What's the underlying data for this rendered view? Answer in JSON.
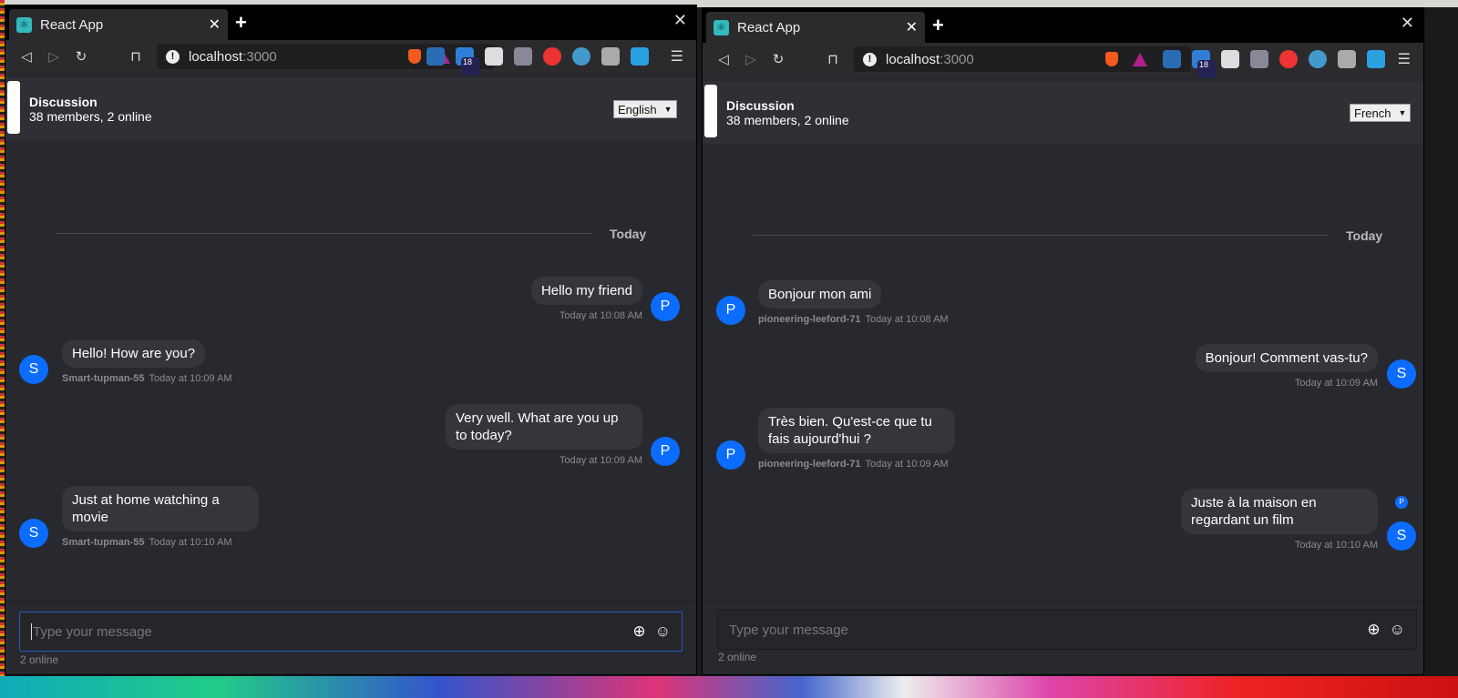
{
  "windows": [
    {
      "tab_title": "React App",
      "url_host": "localhost",
      "url_port": ":3000",
      "ext_badge": "18",
      "header": {
        "title": "Discussion",
        "subtitle": "38 members, 2 online"
      },
      "language": "English",
      "date_label": "Today",
      "messages": [
        {
          "side": "right",
          "text": "Hello my friend",
          "avatar": "P",
          "author": "",
          "time": "Today at 10:08 AM"
        },
        {
          "side": "left",
          "text": "Hello! How are you?",
          "avatar": "S",
          "author": "Smart-tupman-55",
          "time": "Today at 10:09 AM"
        },
        {
          "side": "right",
          "text": "Very well. What are you up to today?",
          "avatar": "P",
          "author": "",
          "time": "Today at 10:09 AM"
        },
        {
          "side": "left",
          "text": "Just at home watching a movie",
          "avatar": "S",
          "author": "Smart-tupman-55",
          "time": "Today at 10:10 AM"
        }
      ],
      "input_placeholder": "Type your message",
      "online_status": "2 online"
    },
    {
      "tab_title": "React App",
      "url_host": "localhost",
      "url_port": ":3000",
      "ext_badge": "18",
      "header": {
        "title": "Discussion",
        "subtitle": "38 members, 2 online"
      },
      "language": "French",
      "date_label": "Today",
      "messages": [
        {
          "side": "left",
          "text": "Bonjour mon ami",
          "avatar": "P",
          "author": "pioneering-leeford-71",
          "time": "Today at 10:08 AM"
        },
        {
          "side": "right",
          "text": "Bonjour! Comment vas-tu?",
          "avatar": "S",
          "author": "",
          "time": "Today at 10:09 AM"
        },
        {
          "side": "left",
          "text": "Très bien. Qu'est-ce que tu fais aujourd'hui ?",
          "avatar": "P",
          "author": "pioneering-leeford-71",
          "time": "Today at 10:09 AM"
        },
        {
          "side": "right",
          "text": "Juste à la maison en regardant un film",
          "avatar": "S",
          "author": "",
          "time": "Today at 10:10 AM",
          "read_by": "P"
        }
      ],
      "input_placeholder": "Type your message",
      "online_status": "2 online"
    }
  ],
  "colors": {
    "accent": "#0b6cff",
    "background": "#28292e",
    "bubble": "#35363b"
  }
}
